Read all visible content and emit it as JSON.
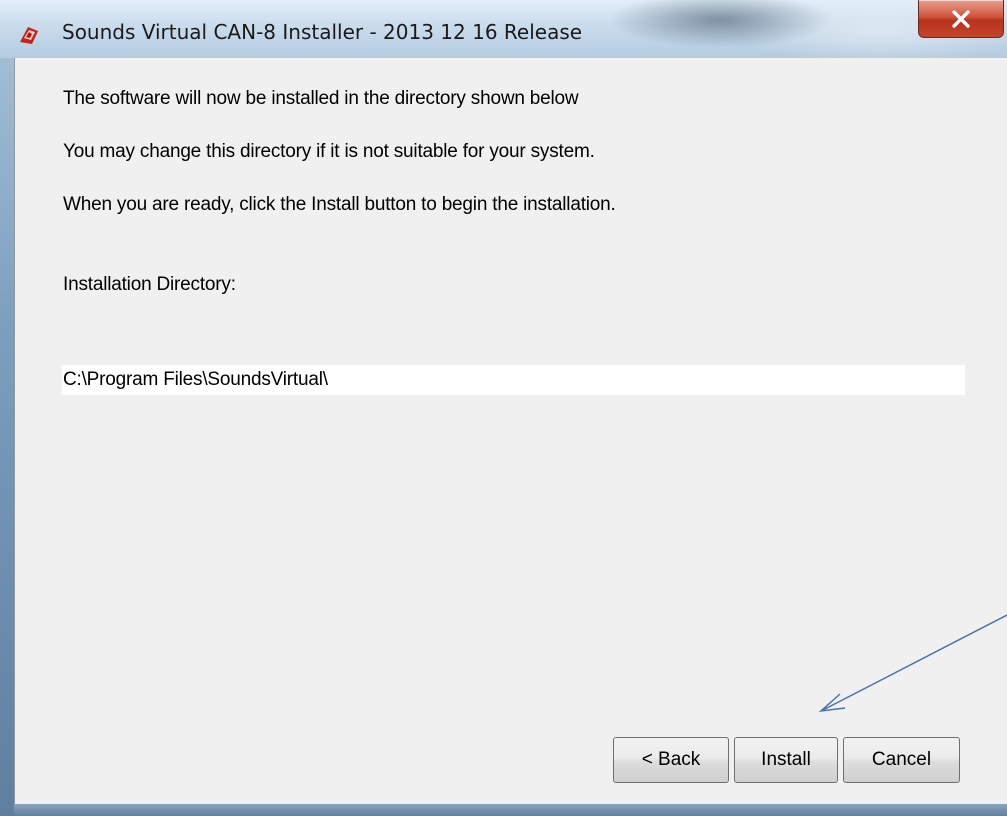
{
  "window": {
    "title": "Sounds Virtual CAN-8 Installer - 2013 12 16 Release",
    "close_label": "x"
  },
  "content": {
    "line1": "The software will now be installed in the directory shown below",
    "line2": "You may change this directory if it is not suitable for your system.",
    "line3": "When you are ready, click the Install button to begin the installation.",
    "dir_label": "Installation Directory:",
    "dir_value": "C:\\Program Files\\SoundsVirtual\\"
  },
  "buttons": {
    "back": "< Back",
    "install": "Install",
    "cancel": "Cancel"
  },
  "icons": {
    "app": "can8-app-icon",
    "close": "close-icon",
    "annotation": "arrow-annotation"
  },
  "colors": {
    "close_red": "#c4452a",
    "arrow_blue": "#4a72b0"
  }
}
